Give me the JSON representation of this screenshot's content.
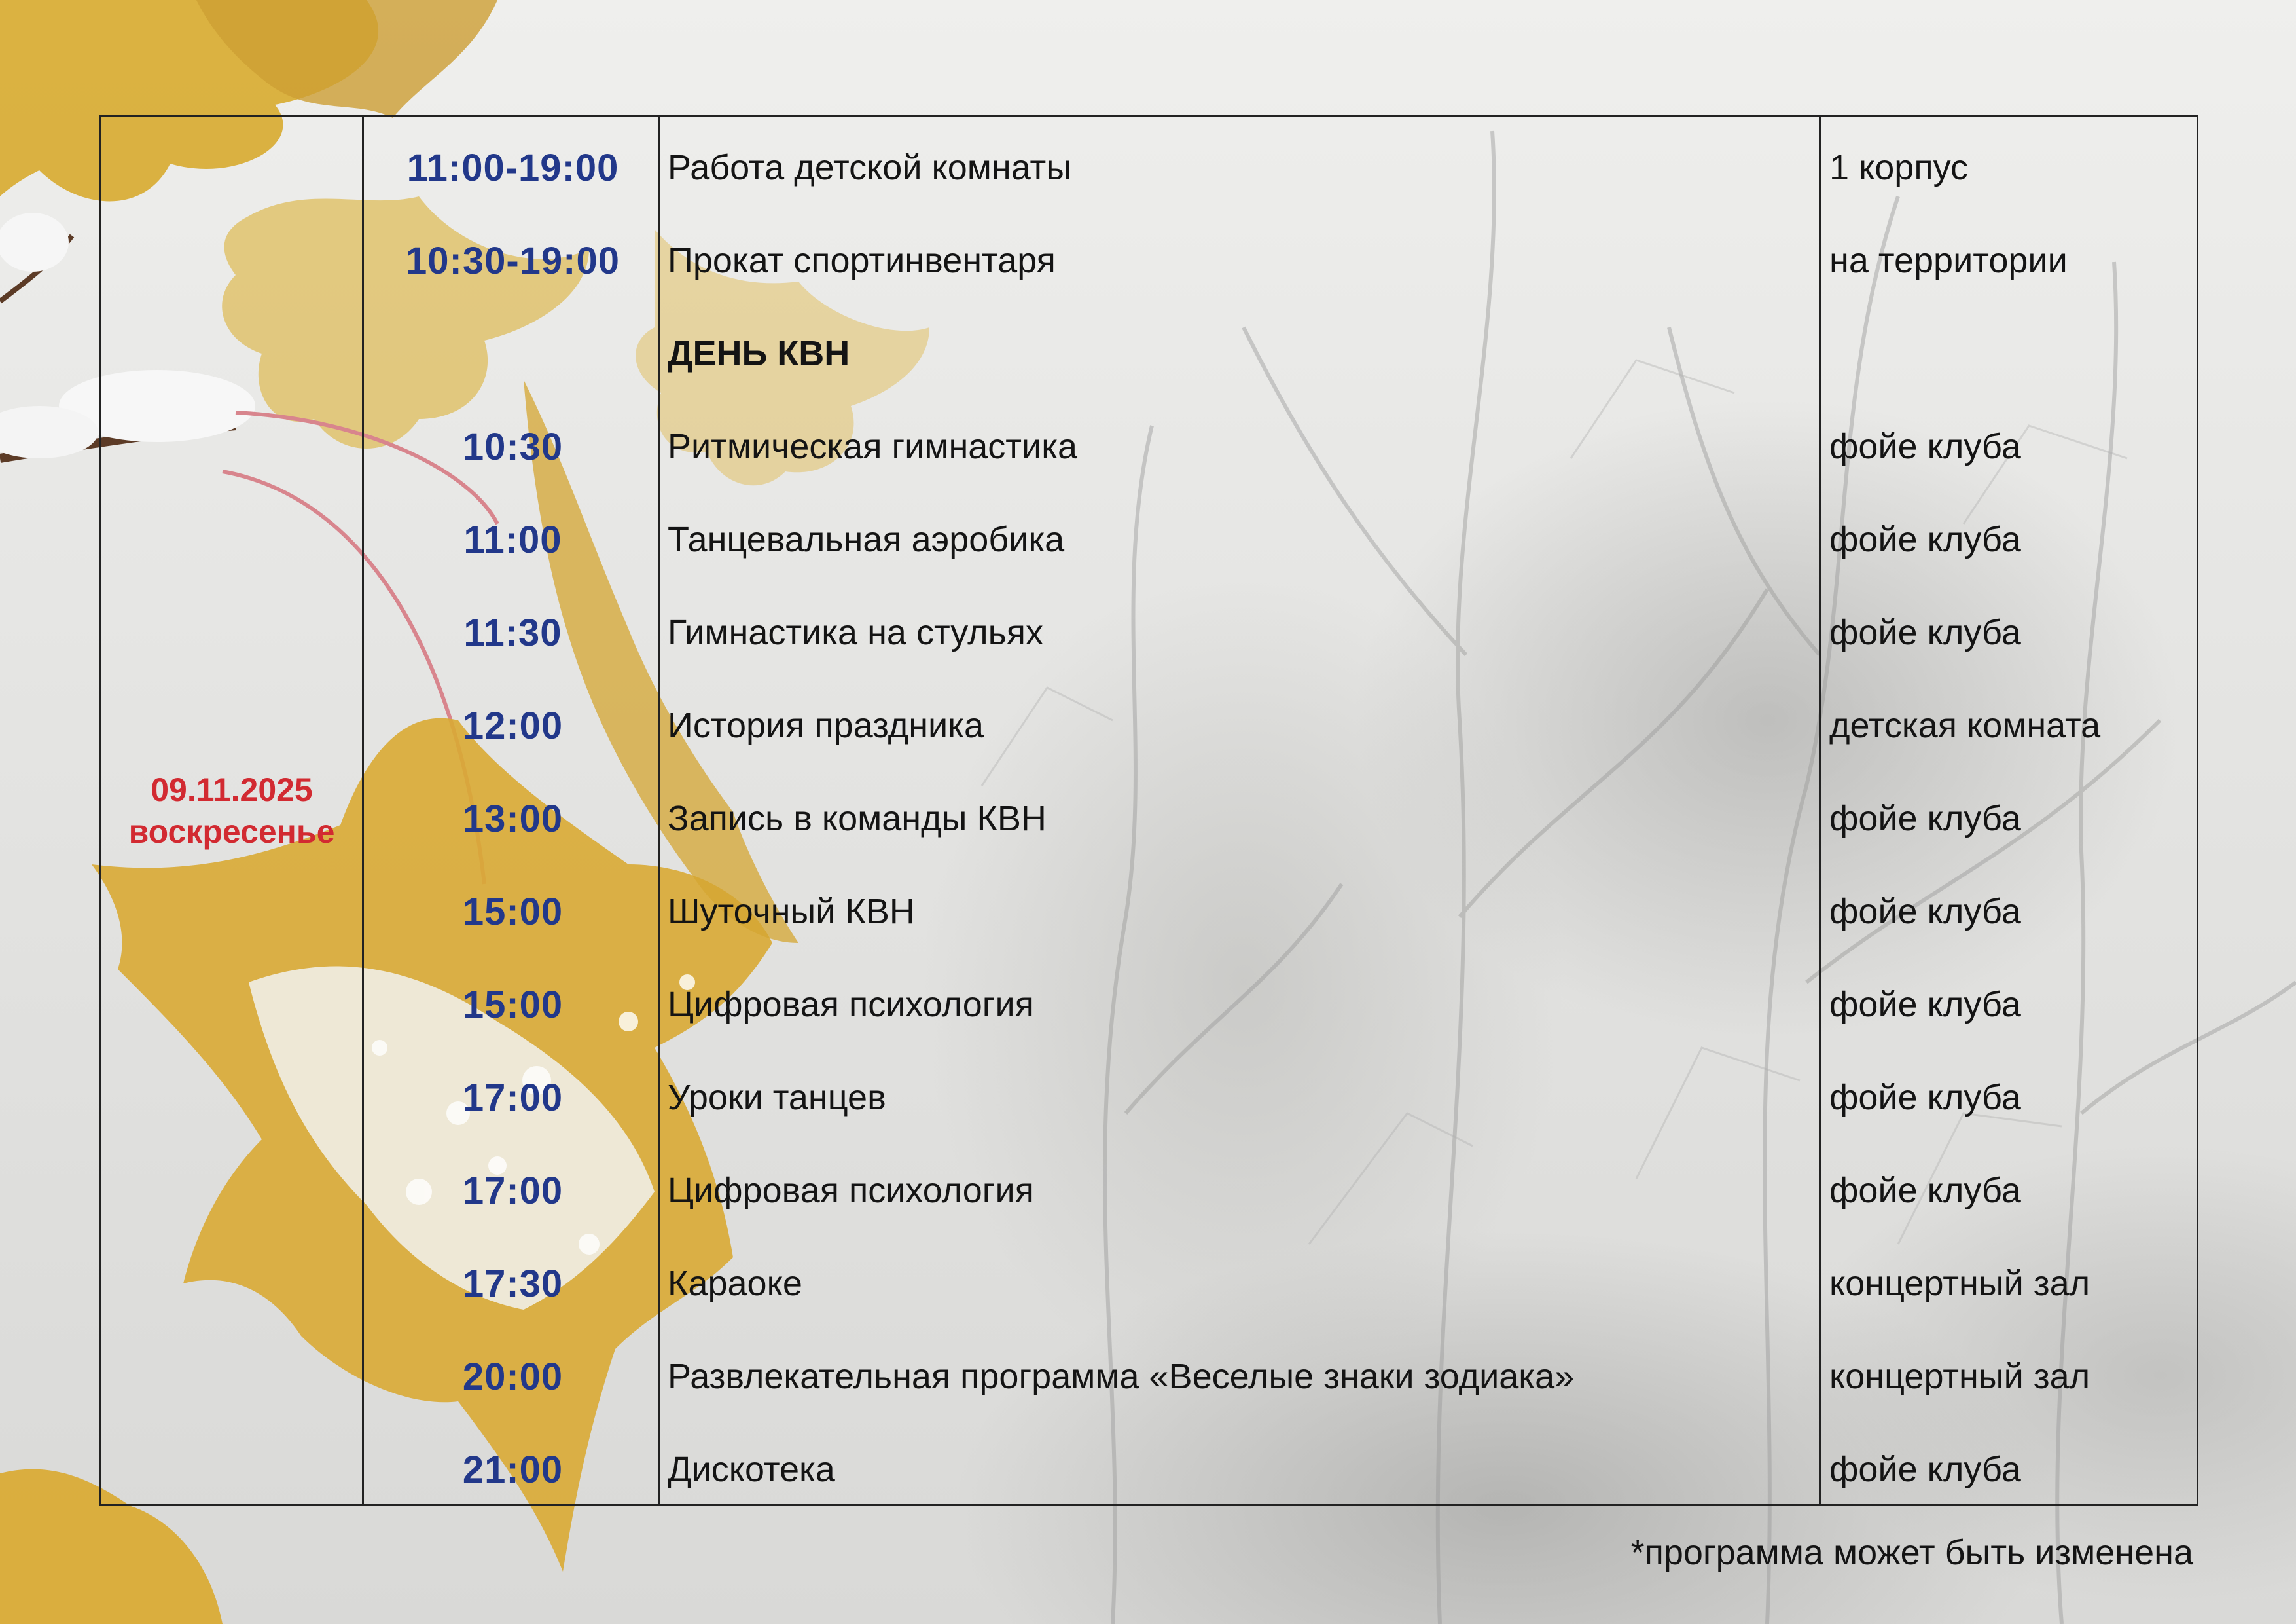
{
  "schedule": {
    "date": "09.11.2025",
    "weekday": "воскресенье",
    "rows": [
      {
        "time": "11:00-19:00",
        "event": "Работа детской комнаты",
        "place": "1 корпус"
      },
      {
        "time": "10:30-19:00",
        "event": "Прокат спортинвентаря",
        "place": "на территории"
      },
      {
        "time": "",
        "event": "ДЕНЬ КВН",
        "place": ""
      },
      {
        "time": "10:30",
        "event": "Ритмическая гимнастика",
        "place": "фойе клуба"
      },
      {
        "time": "11:00",
        "event": "Танцевальная аэробика",
        "place": "фойе клуба"
      },
      {
        "time": "11:30",
        "event": "Гимнастика на стульях",
        "place": "фойе клуба"
      },
      {
        "time": "12:00",
        "event": "История праздника",
        "place": "детская комната"
      },
      {
        "time": "13:00",
        "event": "Запись в команды КВН",
        "place": "фойе клуба"
      },
      {
        "time": "15:00",
        "event": "Шуточный КВН",
        "place": "фойе клуба"
      },
      {
        "time": "15:00",
        "event": "Цифровая психология",
        "place": "фойе клуба"
      },
      {
        "time": "17:00",
        "event": "Уроки танцев",
        "place": "фойе клуба"
      },
      {
        "time": "17:00",
        "event": "Цифровая психология",
        "place": "фойе клуба"
      },
      {
        "time": "17:30",
        "event": "Караоке",
        "place": "концертный зал"
      },
      {
        "time": "20:00",
        "event": "Развлекательная программа «Веселые знаки зодиака»",
        "place": "концертный зал"
      },
      {
        "time": "21:00",
        "event": "Дискотека",
        "place": "фойе клуба"
      }
    ]
  },
  "footnote": "*программа может быть изменена",
  "colors": {
    "date": "#d22a31",
    "time": "#22388a",
    "text": "#141414"
  }
}
